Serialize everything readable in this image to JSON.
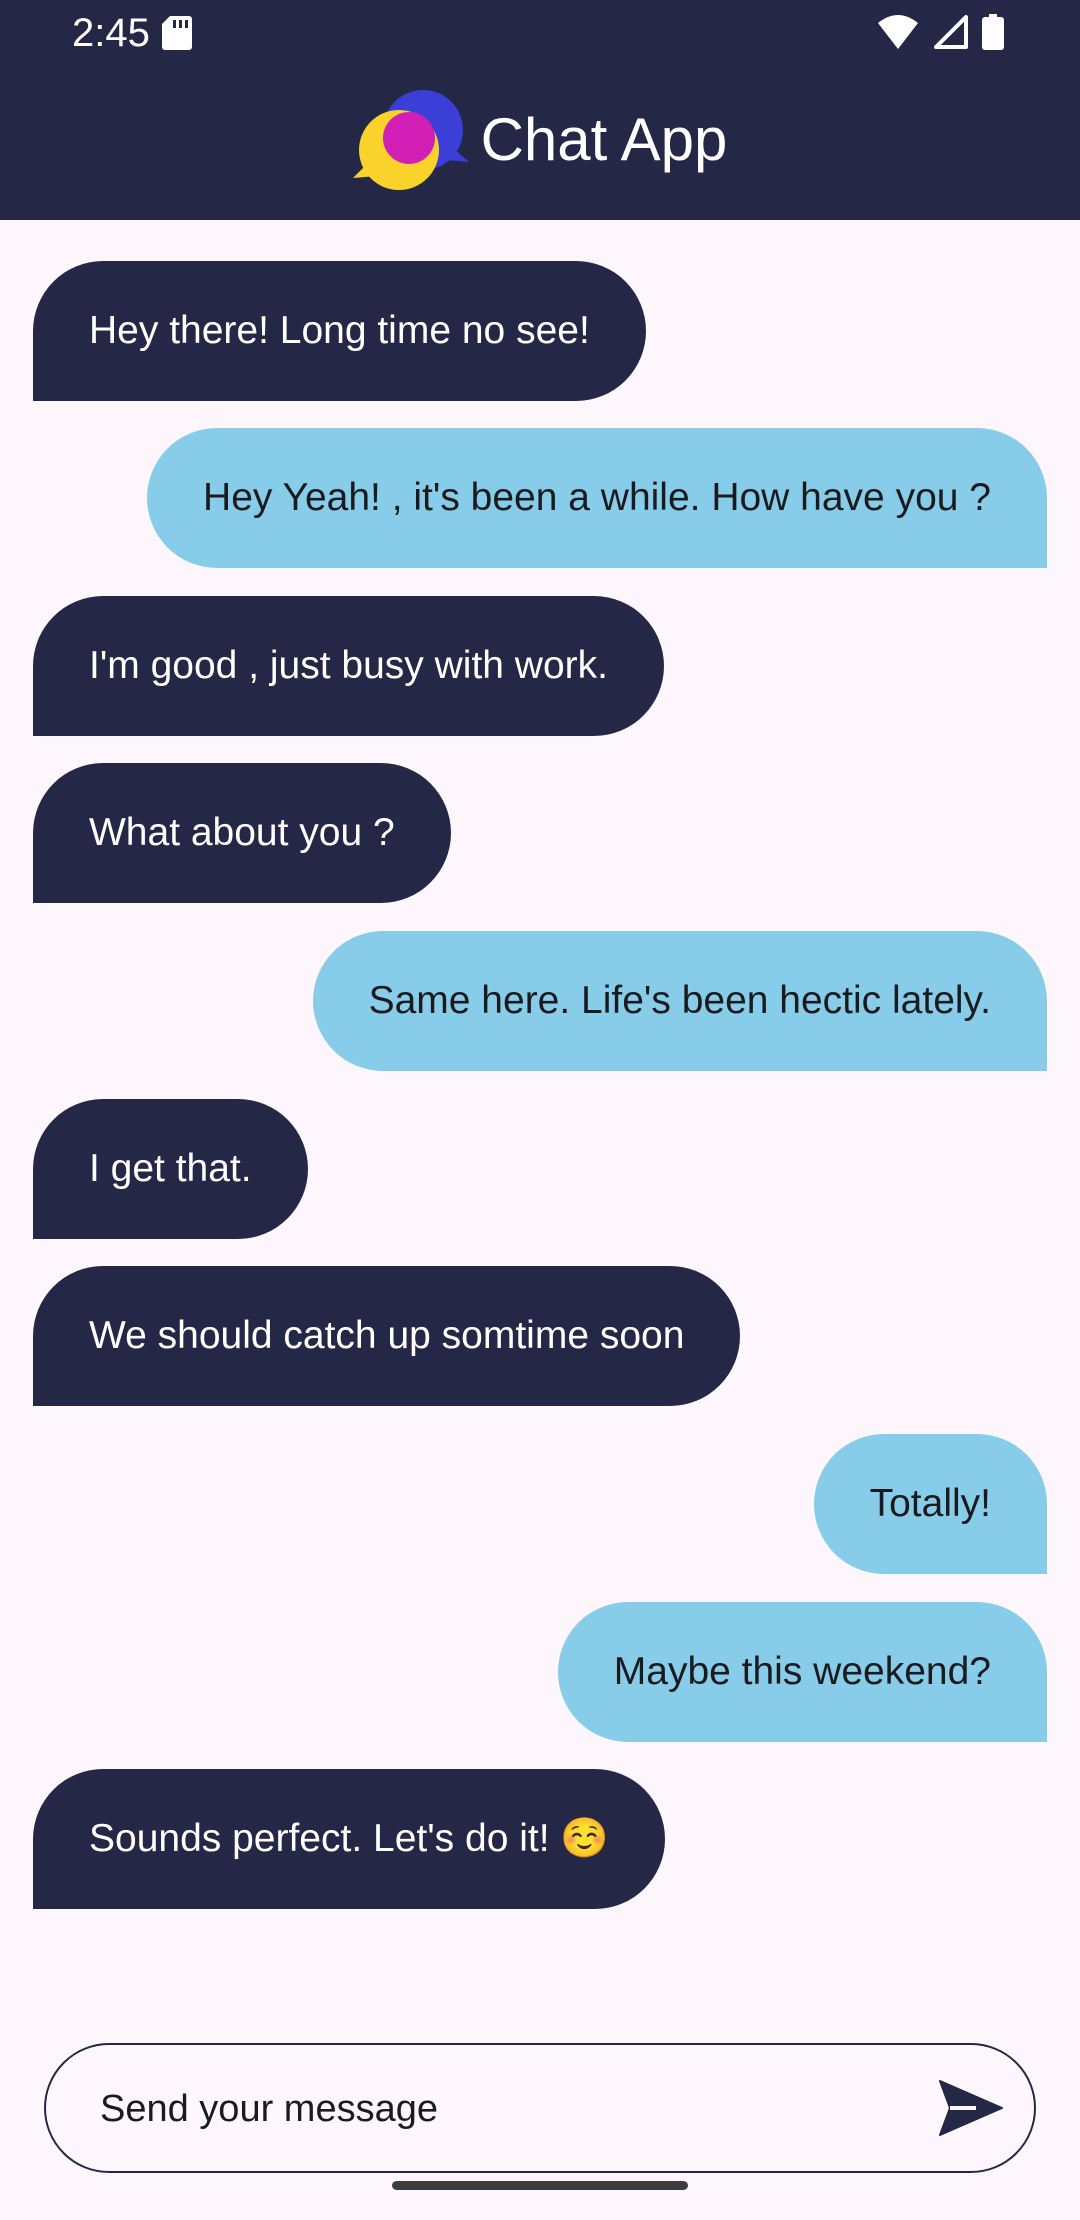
{
  "status_bar": {
    "time": "2:45",
    "icons": [
      "sd-card-icon",
      "wifi-icon",
      "cellular-signal-icon",
      "battery-icon"
    ]
  },
  "app_bar": {
    "title": "Chat App",
    "logo": "chat-bubbles-logo-icon"
  },
  "messages": [
    {
      "direction": "incoming",
      "text": "Hey there! Long time no see!"
    },
    {
      "direction": "outgoing",
      "text": "Hey Yeah! , it's been a while. How have you ?"
    },
    {
      "direction": "incoming",
      "text": "I'm good , just busy with work."
    },
    {
      "direction": "incoming",
      "text": "What about you ?"
    },
    {
      "direction": "outgoing",
      "text": "Same here. Life's been hectic lately."
    },
    {
      "direction": "incoming",
      "text": "I get that."
    },
    {
      "direction": "incoming",
      "text": "We should catch up somtime soon"
    },
    {
      "direction": "outgoing",
      "text": "Totally!"
    },
    {
      "direction": "outgoing",
      "text": "Maybe this weekend?"
    },
    {
      "direction": "incoming",
      "text": "Sounds perfect. Let's do it! ☺️"
    }
  ],
  "composer": {
    "placeholder": "Send your message",
    "value": "",
    "send_icon": "send-icon"
  },
  "colors": {
    "header": "#242846",
    "incoming_bubble": "#242846",
    "outgoing_bubble": "#87cde9",
    "background": "#fdf7fd"
  }
}
